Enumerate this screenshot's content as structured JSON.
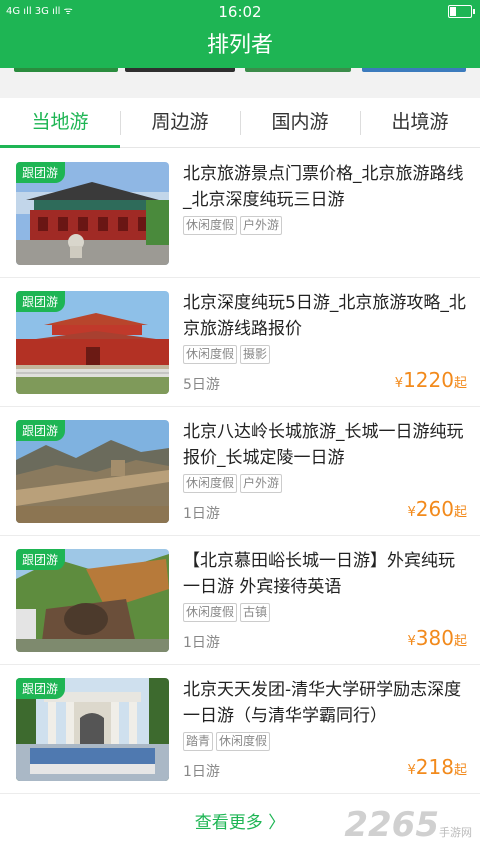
{
  "status": {
    "time": "16:02",
    "left_icons": "4G ıll 3G ıll ᯤ"
  },
  "header": {
    "title": "排列者"
  },
  "tabs": [
    {
      "label": "当地游",
      "active": true
    },
    {
      "label": "周边游",
      "active": false
    },
    {
      "label": "国内游",
      "active": false
    },
    {
      "label": "出境游",
      "active": false
    }
  ],
  "items": [
    {
      "badge": "跟团游",
      "title": "北京旅游景点门票价格_北京旅游路线_北京深度纯玩三日游",
      "tags": [
        "休闲度假",
        "户外游"
      ],
      "days": "",
      "price_symbol": "",
      "price": "",
      "price_unit": ""
    },
    {
      "badge": "跟团游",
      "title": "北京深度纯玩5日游_北京旅游攻略_北京旅游线路报价",
      "tags": [
        "休闲度假",
        "摄影"
      ],
      "days": "5日游",
      "price_symbol": "¥",
      "price": "1220",
      "price_unit": "起"
    },
    {
      "badge": "跟团游",
      "title": "北京八达岭长城旅游_长城一日游纯玩报价_长城定陵一日游",
      "tags": [
        "休闲度假",
        "户外游"
      ],
      "days": "1日游",
      "price_symbol": "¥",
      "price": "260",
      "price_unit": "起"
    },
    {
      "badge": "跟团游",
      "title": "【北京慕田峪长城一日游】外宾纯玩一日游 外宾接待英语",
      "tags": [
        "休闲度假",
        "古镇"
      ],
      "days": "1日游",
      "price_symbol": "¥",
      "price": "380",
      "price_unit": "起"
    },
    {
      "badge": "跟团游",
      "title": "北京天天发团-清华大学研学励志深度一日游（与清华学霸同行）",
      "tags": [
        "踏青",
        "休闲度假"
      ],
      "days": "1日游",
      "price_symbol": "¥",
      "price": "218",
      "price_unit": "起"
    }
  ],
  "more": {
    "label": "查看更多 〉"
  },
  "watermark": {
    "brand": "2265",
    "sub": "手游网"
  }
}
